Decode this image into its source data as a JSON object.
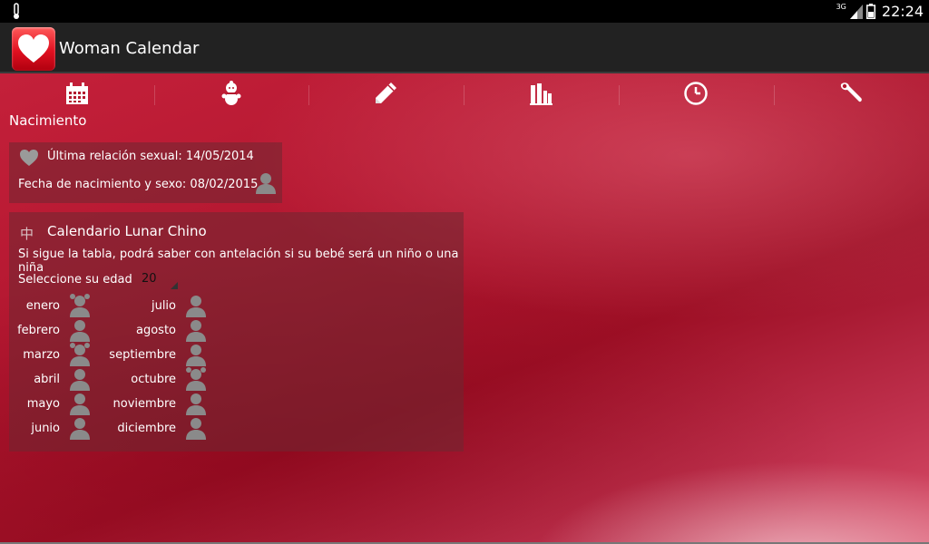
{
  "status_bar": {
    "network": "3G",
    "time": "22:24",
    "left_icon": "thermometer-icon",
    "signal_icon": "signal-icon",
    "battery_icon": "battery-icon"
  },
  "app": {
    "title": "Woman Calendar",
    "icon": "heart-logo-icon",
    "brand_color": "#e01020"
  },
  "toolbar": {
    "items": [
      {
        "icon": "calendar-icon"
      },
      {
        "icon": "baby-icon"
      },
      {
        "icon": "pencil-icon"
      },
      {
        "icon": "bar-chart-icon"
      },
      {
        "icon": "clock-icon"
      },
      {
        "icon": "wrench-icon"
      }
    ]
  },
  "section": {
    "title": "Nacimiento"
  },
  "summary": {
    "last_relation": "Última relación sexual: 14/05/2014",
    "birth_date": "Fecha de nacimiento y sexo: 08/02/2015"
  },
  "lunar": {
    "title": "Calendario Lunar Chino",
    "description": "Si sigue la tabla, podrá saber con antelación si su bebé será un niño o una niña",
    "age_label": "Seleccione su edad",
    "age_value": "20",
    "months": [
      {
        "name": "enero",
        "gender": "girl"
      },
      {
        "name": "febrero",
        "gender": "boy"
      },
      {
        "name": "marzo",
        "gender": "girl"
      },
      {
        "name": "abril",
        "gender": "boy"
      },
      {
        "name": "mayo",
        "gender": "boy"
      },
      {
        "name": "junio",
        "gender": "boy"
      },
      {
        "name": "julio",
        "gender": "boy"
      },
      {
        "name": "agosto",
        "gender": "boy"
      },
      {
        "name": "septiembre",
        "gender": "boy"
      },
      {
        "name": "octubre",
        "gender": "girl"
      },
      {
        "name": "noviembre",
        "gender": "boy"
      },
      {
        "name": "diciembre",
        "gender": "boy"
      }
    ]
  }
}
